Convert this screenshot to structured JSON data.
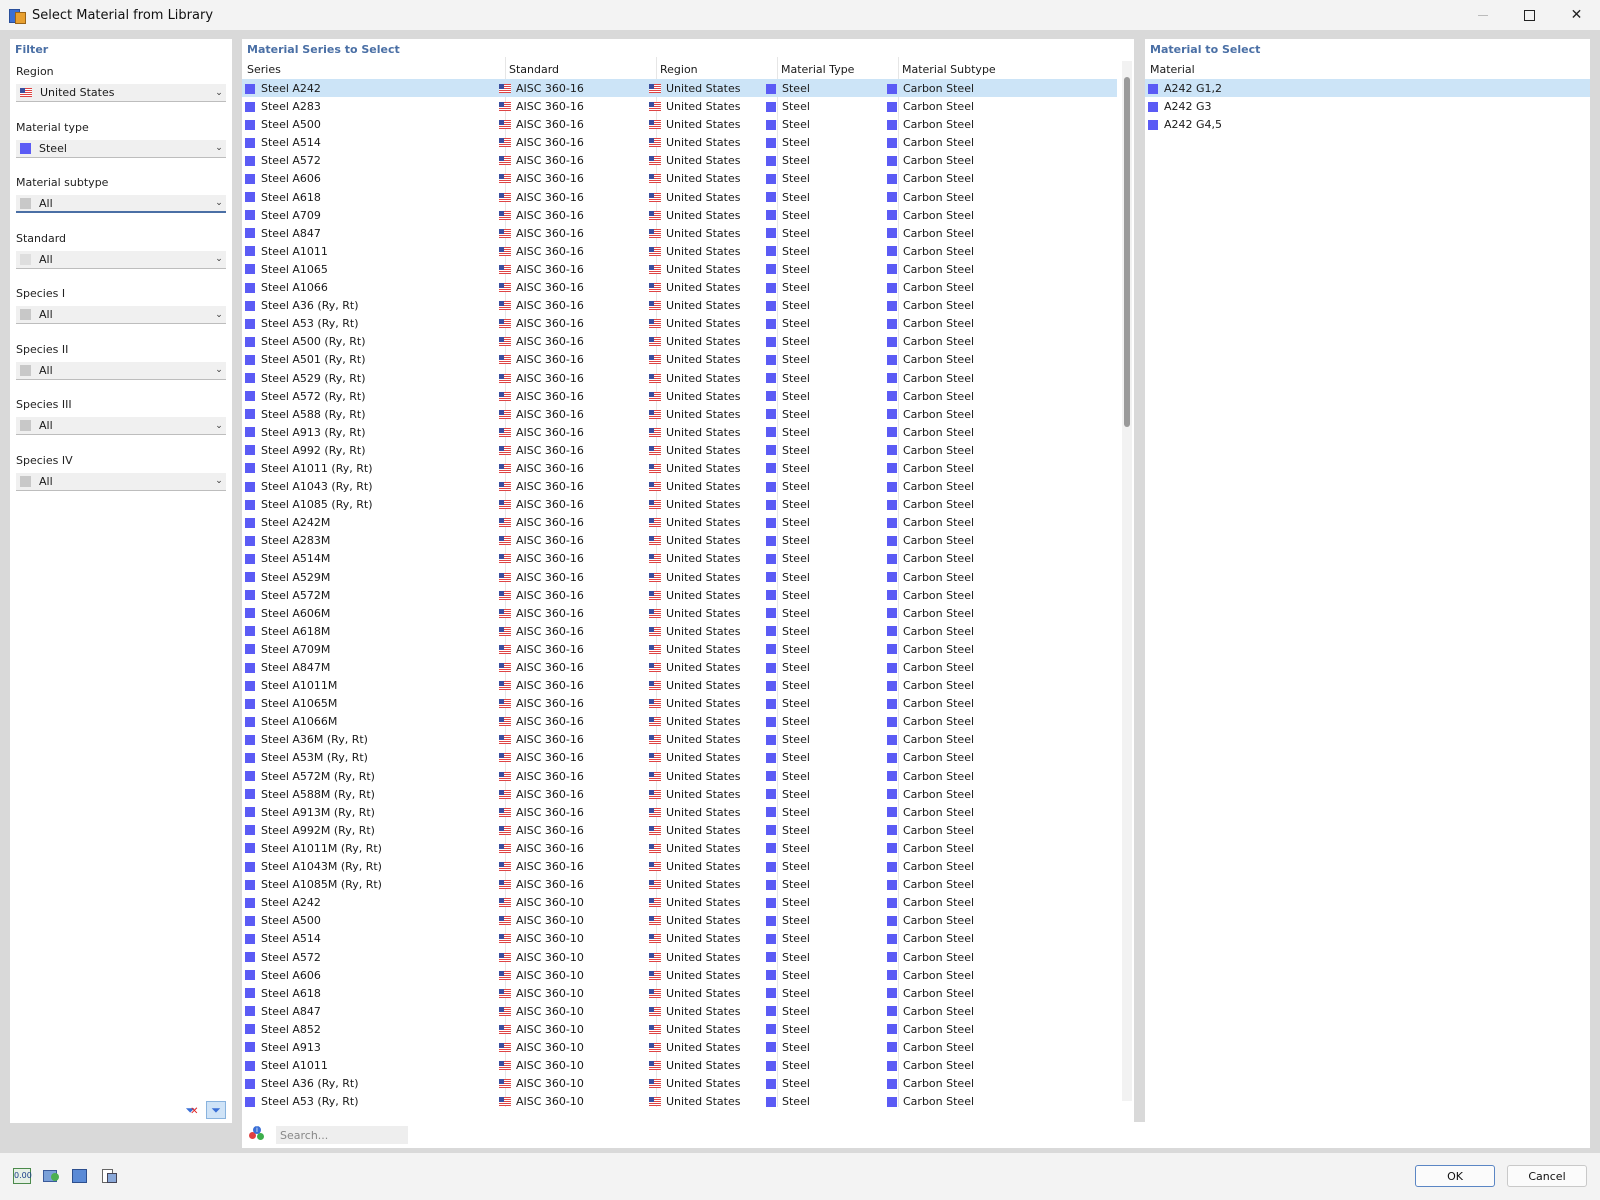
{
  "window": {
    "title": "Select Material from Library"
  },
  "filter": {
    "title": "Filter",
    "fields": [
      {
        "label": "Region",
        "value": "United States",
        "icon": "flag-us"
      },
      {
        "label": "Material type",
        "value": "Steel",
        "icon": "blue-square"
      },
      {
        "label": "Material subtype",
        "value": "All",
        "icon": "gray-square"
      },
      {
        "label": "Standard",
        "value": "All",
        "icon": "light-square"
      },
      {
        "label": "Species I",
        "value": "All",
        "icon": "gray-square"
      },
      {
        "label": "Species II",
        "value": "All",
        "icon": "gray-square"
      },
      {
        "label": "Species III",
        "value": "All",
        "icon": "gray-square"
      },
      {
        "label": "Species IV",
        "value": "All",
        "icon": "gray-square"
      }
    ]
  },
  "series": {
    "title": "Material Series to Select",
    "columns": [
      "Series",
      "Standard",
      "Region",
      "Material Type",
      "Material Subtype"
    ],
    "rows": [
      [
        "Steel A242",
        "AISC 360-16",
        "United States",
        "Steel",
        "Carbon Steel"
      ],
      [
        "Steel A283",
        "AISC 360-16",
        "United States",
        "Steel",
        "Carbon Steel"
      ],
      [
        "Steel A500",
        "AISC 360-16",
        "United States",
        "Steel",
        "Carbon Steel"
      ],
      [
        "Steel A514",
        "AISC 360-16",
        "United States",
        "Steel",
        "Carbon Steel"
      ],
      [
        "Steel A572",
        "AISC 360-16",
        "United States",
        "Steel",
        "Carbon Steel"
      ],
      [
        "Steel A606",
        "AISC 360-16",
        "United States",
        "Steel",
        "Carbon Steel"
      ],
      [
        "Steel A618",
        "AISC 360-16",
        "United States",
        "Steel",
        "Carbon Steel"
      ],
      [
        "Steel A709",
        "AISC 360-16",
        "United States",
        "Steel",
        "Carbon Steel"
      ],
      [
        "Steel A847",
        "AISC 360-16",
        "United States",
        "Steel",
        "Carbon Steel"
      ],
      [
        "Steel A1011",
        "AISC 360-16",
        "United States",
        "Steel",
        "Carbon Steel"
      ],
      [
        "Steel A1065",
        "AISC 360-16",
        "United States",
        "Steel",
        "Carbon Steel"
      ],
      [
        "Steel A1066",
        "AISC 360-16",
        "United States",
        "Steel",
        "Carbon Steel"
      ],
      [
        "Steel A36 (Ry, Rt)",
        "AISC 360-16",
        "United States",
        "Steel",
        "Carbon Steel"
      ],
      [
        "Steel A53 (Ry, Rt)",
        "AISC 360-16",
        "United States",
        "Steel",
        "Carbon Steel"
      ],
      [
        "Steel A500 (Ry, Rt)",
        "AISC 360-16",
        "United States",
        "Steel",
        "Carbon Steel"
      ],
      [
        "Steel A501 (Ry, Rt)",
        "AISC 360-16",
        "United States",
        "Steel",
        "Carbon Steel"
      ],
      [
        "Steel A529 (Ry, Rt)",
        "AISC 360-16",
        "United States",
        "Steel",
        "Carbon Steel"
      ],
      [
        "Steel A572 (Ry, Rt)",
        "AISC 360-16",
        "United States",
        "Steel",
        "Carbon Steel"
      ],
      [
        "Steel A588 (Ry, Rt)",
        "AISC 360-16",
        "United States",
        "Steel",
        "Carbon Steel"
      ],
      [
        "Steel A913 (Ry, Rt)",
        "AISC 360-16",
        "United States",
        "Steel",
        "Carbon Steel"
      ],
      [
        "Steel A992 (Ry, Rt)",
        "AISC 360-16",
        "United States",
        "Steel",
        "Carbon Steel"
      ],
      [
        "Steel A1011 (Ry, Rt)",
        "AISC 360-16",
        "United States",
        "Steel",
        "Carbon Steel"
      ],
      [
        "Steel A1043 (Ry, Rt)",
        "AISC 360-16",
        "United States",
        "Steel",
        "Carbon Steel"
      ],
      [
        "Steel A1085 (Ry, Rt)",
        "AISC 360-16",
        "United States",
        "Steel",
        "Carbon Steel"
      ],
      [
        "Steel A242M",
        "AISC 360-16",
        "United States",
        "Steel",
        "Carbon Steel"
      ],
      [
        "Steel A283M",
        "AISC 360-16",
        "United States",
        "Steel",
        "Carbon Steel"
      ],
      [
        "Steel A514M",
        "AISC 360-16",
        "United States",
        "Steel",
        "Carbon Steel"
      ],
      [
        "Steel A529M",
        "AISC 360-16",
        "United States",
        "Steel",
        "Carbon Steel"
      ],
      [
        "Steel A572M",
        "AISC 360-16",
        "United States",
        "Steel",
        "Carbon Steel"
      ],
      [
        "Steel A606M",
        "AISC 360-16",
        "United States",
        "Steel",
        "Carbon Steel"
      ],
      [
        "Steel A618M",
        "AISC 360-16",
        "United States",
        "Steel",
        "Carbon Steel"
      ],
      [
        "Steel A709M",
        "AISC 360-16",
        "United States",
        "Steel",
        "Carbon Steel"
      ],
      [
        "Steel A847M",
        "AISC 360-16",
        "United States",
        "Steel",
        "Carbon Steel"
      ],
      [
        "Steel A1011M",
        "AISC 360-16",
        "United States",
        "Steel",
        "Carbon Steel"
      ],
      [
        "Steel A1065M",
        "AISC 360-16",
        "United States",
        "Steel",
        "Carbon Steel"
      ],
      [
        "Steel A1066M",
        "AISC 360-16",
        "United States",
        "Steel",
        "Carbon Steel"
      ],
      [
        "Steel A36M (Ry, Rt)",
        "AISC 360-16",
        "United States",
        "Steel",
        "Carbon Steel"
      ],
      [
        "Steel A53M (Ry, Rt)",
        "AISC 360-16",
        "United States",
        "Steel",
        "Carbon Steel"
      ],
      [
        "Steel A572M (Ry, Rt)",
        "AISC 360-16",
        "United States",
        "Steel",
        "Carbon Steel"
      ],
      [
        "Steel A588M (Ry, Rt)",
        "AISC 360-16",
        "United States",
        "Steel",
        "Carbon Steel"
      ],
      [
        "Steel A913M (Ry, Rt)",
        "AISC 360-16",
        "United States",
        "Steel",
        "Carbon Steel"
      ],
      [
        "Steel A992M (Ry, Rt)",
        "AISC 360-16",
        "United States",
        "Steel",
        "Carbon Steel"
      ],
      [
        "Steel A1011M (Ry, Rt)",
        "AISC 360-16",
        "United States",
        "Steel",
        "Carbon Steel"
      ],
      [
        "Steel A1043M (Ry, Rt)",
        "AISC 360-16",
        "United States",
        "Steel",
        "Carbon Steel"
      ],
      [
        "Steel A1085M (Ry, Rt)",
        "AISC 360-16",
        "United States",
        "Steel",
        "Carbon Steel"
      ],
      [
        "Steel A242",
        "AISC 360-10",
        "United States",
        "Steel",
        "Carbon Steel"
      ],
      [
        "Steel A500",
        "AISC 360-10",
        "United States",
        "Steel",
        "Carbon Steel"
      ],
      [
        "Steel A514",
        "AISC 360-10",
        "United States",
        "Steel",
        "Carbon Steel"
      ],
      [
        "Steel A572",
        "AISC 360-10",
        "United States",
        "Steel",
        "Carbon Steel"
      ],
      [
        "Steel A606",
        "AISC 360-10",
        "United States",
        "Steel",
        "Carbon Steel"
      ],
      [
        "Steel A618",
        "AISC 360-10",
        "United States",
        "Steel",
        "Carbon Steel"
      ],
      [
        "Steel A847",
        "AISC 360-10",
        "United States",
        "Steel",
        "Carbon Steel"
      ],
      [
        "Steel A852",
        "AISC 360-10",
        "United States",
        "Steel",
        "Carbon Steel"
      ],
      [
        "Steel A913",
        "AISC 360-10",
        "United States",
        "Steel",
        "Carbon Steel"
      ],
      [
        "Steel A1011",
        "AISC 360-10",
        "United States",
        "Steel",
        "Carbon Steel"
      ],
      [
        "Steel A36 (Ry, Rt)",
        "AISC 360-10",
        "United States",
        "Steel",
        "Carbon Steel"
      ],
      [
        "Steel A53 (Ry, Rt)",
        "AISC 360-10",
        "United States",
        "Steel",
        "Carbon Steel"
      ]
    ]
  },
  "material": {
    "title": "Material to Select",
    "column": "Material",
    "rows": [
      "A242 G1,2",
      "A242 G3",
      "A242 G4,5"
    ]
  },
  "search": {
    "placeholder": "Search..."
  },
  "footer": {
    "ok_label": "OK",
    "cancel_label": "Cancel",
    "units_icon_text": "0.00"
  },
  "colors": {
    "accent": "#4a6fa5",
    "selection": "#cce4f7",
    "material_swatch": "#5b5bf5"
  }
}
